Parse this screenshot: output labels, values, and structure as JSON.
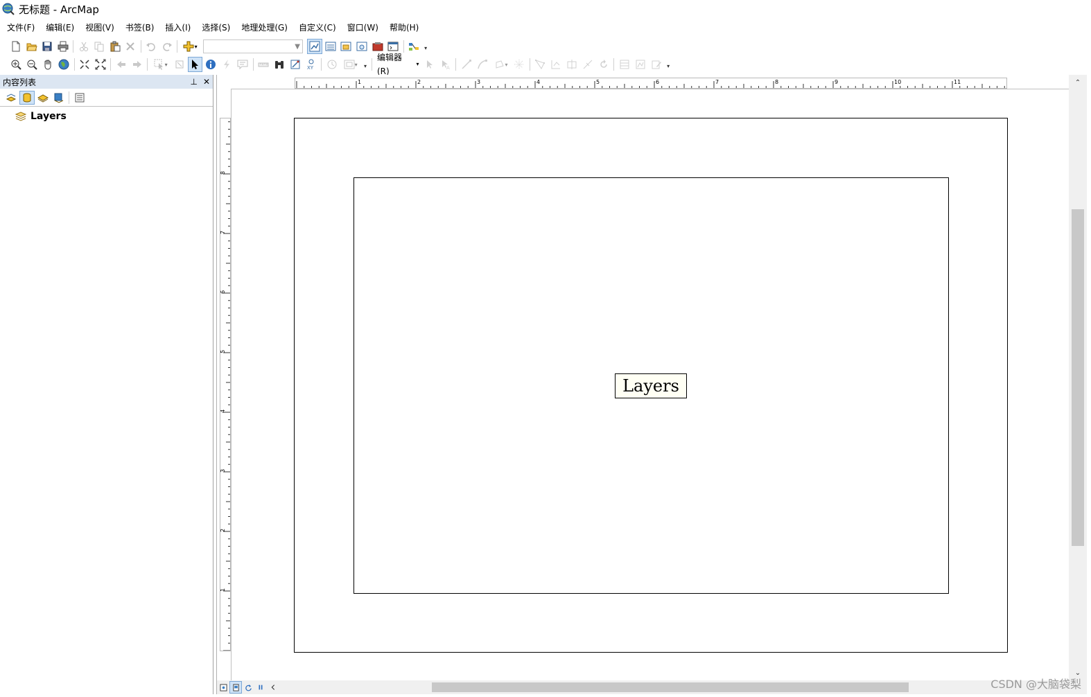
{
  "window": {
    "title": "无标题 - ArcMap"
  },
  "menubar": {
    "items": [
      {
        "label": "文件(F)"
      },
      {
        "label": "编辑(E)"
      },
      {
        "label": "视图(V)"
      },
      {
        "label": "书签(B)"
      },
      {
        "label": "插入(I)"
      },
      {
        "label": "选择(S)"
      },
      {
        "label": "地理处理(G)"
      },
      {
        "label": "自定义(C)"
      },
      {
        "label": "窗口(W)"
      },
      {
        "label": "帮助(H)"
      }
    ]
  },
  "toolbar": {
    "scale_value": "",
    "editor_label": "编辑器(R)"
  },
  "toc": {
    "title": "内容列表",
    "layers_label": "Layers"
  },
  "layout": {
    "dataframe_label": "Layers",
    "ruler_h_labels": [
      "1",
      "2",
      "3",
      "4",
      "5",
      "6",
      "7",
      "8",
      "9",
      "10",
      "11"
    ],
    "ruler_v_labels": [
      "8",
      "7",
      "6",
      "5",
      "4",
      "3",
      "2",
      "1"
    ]
  },
  "watermark": "CSDN @大脑袋梨",
  "colors": {
    "toc_header_bg": "#dce6f2",
    "active_tool_bg": "#cfe3f7",
    "scroll_thumb": "#c8c8c8"
  }
}
